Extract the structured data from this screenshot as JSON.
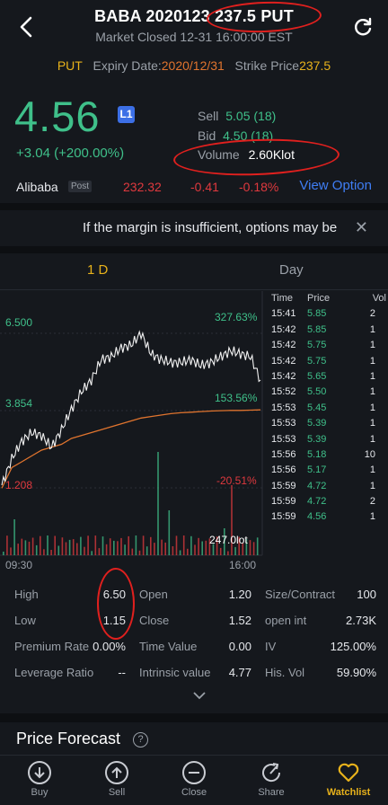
{
  "header": {
    "title_prefix": "BABA 2020123",
    "title_strike": "237.5 PUT",
    "subtitle": "Market Closed 12-31 16:00:00 EST"
  },
  "option_info": {
    "type": "PUT",
    "expiry_label": "Expiry Date:",
    "expiry": "2020/12/31",
    "strike_label": "Strike Price",
    "strike": "237.5"
  },
  "quote": {
    "price": "4.56",
    "level_badge": "L1",
    "change": "+3.04 (+200.00%)",
    "sell_label": "Sell",
    "sell": "5.05 (18)",
    "bid_label": "Bid",
    "bid": "4.50 (18)",
    "volume_label": "Volume",
    "volume": "2.60Klot"
  },
  "underlying": {
    "name": "Alibaba",
    "badge": "Post",
    "price": "232.32",
    "change": "-0.41",
    "change_pct": "-0.18%",
    "link": "View Option"
  },
  "notice": {
    "text": "If the margin is insufficient, options may be"
  },
  "tabs": [
    "1 D",
    "Day"
  ],
  "chart_labels": {
    "high": "6.500",
    "mid": "3.854",
    "low": "1.208",
    "high_pct": "327.63%",
    "mid_pct": "153.56%",
    "low_pct": "-20.51%",
    "volume": "247.0lot",
    "time_start": "09:30",
    "time_end": "16:00"
  },
  "trades": {
    "headers": [
      "Time",
      "Price",
      "Vol"
    ],
    "rows": [
      [
        "15:41",
        "5.85",
        "2"
      ],
      [
        "15:42",
        "5.85",
        "1"
      ],
      [
        "15:42",
        "5.75",
        "1"
      ],
      [
        "15:42",
        "5.75",
        "1"
      ],
      [
        "15:42",
        "5.65",
        "1"
      ],
      [
        "15:52",
        "5.50",
        "1"
      ],
      [
        "15:53",
        "5.45",
        "1"
      ],
      [
        "15:53",
        "5.39",
        "1"
      ],
      [
        "15:53",
        "5.39",
        "1"
      ],
      [
        "15:56",
        "5.18",
        "10"
      ],
      [
        "15:56",
        "5.17",
        "1"
      ],
      [
        "15:59",
        "4.72",
        "1"
      ],
      [
        "15:59",
        "4.72",
        "2"
      ],
      [
        "15:59",
        "4.56",
        "1"
      ]
    ]
  },
  "stats": [
    [
      [
        "High",
        "6.50"
      ],
      [
        "Open",
        "1.20"
      ],
      [
        "Size/Contract",
        "100"
      ]
    ],
    [
      [
        "Low",
        "1.15"
      ],
      [
        "Close",
        "1.52"
      ],
      [
        "open int",
        "2.73K"
      ]
    ],
    [
      [
        "Premium Rate",
        "0.00%"
      ],
      [
        "Time Value",
        "0.00"
      ],
      [
        "IV",
        "125.00%"
      ]
    ],
    [
      [
        "Leverage Ratio",
        "--"
      ],
      [
        "Intrinsic value",
        "4.77"
      ],
      [
        "His. Vol",
        "59.90%"
      ]
    ]
  ],
  "forecast": {
    "title": "Price Forecast",
    "help": "?"
  },
  "bottom_nav": [
    "Buy",
    "Sell",
    "Close",
    "Share",
    "Watchlist"
  ],
  "colors": {
    "up": "#3fc08a",
    "down": "#e0393e",
    "accent": "#e8b21b",
    "link": "#3f7ef5",
    "avg_line": "#e0742e"
  },
  "chart_data": {
    "type": "line",
    "ylim": [
      1.208,
      6.5
    ],
    "series": [
      {
        "values": [
          1.3,
          2.2,
          2.8,
          3.1,
          3.0,
          2.6,
          3.2,
          3.9,
          4.5,
          4.9,
          5.6,
          5.7,
          6.0,
          6.1,
          6.5,
          5.8,
          5.6,
          5.5,
          5.5,
          5.6,
          5.4,
          5.5,
          5.7,
          5.9,
          5.8,
          5.7,
          4.9
        ]
      },
      {
        "values": [
          1.2,
          1.9,
          2.1,
          2.3,
          2.5,
          2.6,
          2.7,
          2.9,
          3.0,
          3.1,
          3.2,
          3.3,
          3.4,
          3.5,
          3.6,
          3.65,
          3.7,
          3.75,
          3.78,
          3.8,
          3.82,
          3.84,
          3.85,
          3.86,
          3.86,
          3.87,
          3.88
        ]
      }
    ]
  }
}
